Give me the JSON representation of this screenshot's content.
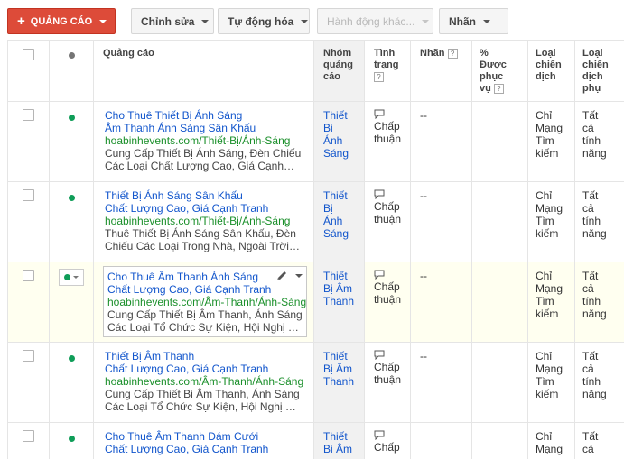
{
  "toolbar": {
    "add_label": "QUẢNG CÁO",
    "edit_label": "Chỉnh sửa",
    "automate_label": "Tự động hóa",
    "more_actions_label": "Hành động khác...",
    "labels_label": "Nhãn"
  },
  "columns": {
    "ad": "Quảng cáo",
    "ad_group": [
      "Nhóm",
      "quảng",
      "cáo"
    ],
    "status": [
      "Tình",
      "trạng"
    ],
    "labels": "Nhãn",
    "percent_served": [
      "%",
      "Được",
      "phục",
      "vụ"
    ],
    "campaign_type": [
      "Loại",
      "chiến",
      "dịch"
    ],
    "campaign_subtype": [
      "Loại",
      "chiến",
      "dịch",
      "phụ"
    ],
    "help_glyph": "?"
  },
  "rows": [
    {
      "headline": "Cho Thuê Thiết Bị Ánh Sáng",
      "headline2": "Âm Thanh Ánh Sáng Sân Khấu",
      "url": "hoabinhevents.com/Thiết-Bị/Ánh-Sáng",
      "desc1": "Cung Cấp Thiết Bị Ánh Sáng, Đèn Chiếu",
      "desc2": "Các Loại Chất Lượng Cao, Giá Cạnh…",
      "ad_group": [
        "Thiết",
        "Bị",
        "Ánh",
        "Sáng"
      ],
      "status": [
        "Chấp",
        "thuận"
      ],
      "labels": "--",
      "campaign_type": [
        "Chỉ",
        "Mạng",
        "Tìm",
        "kiếm"
      ],
      "campaign_subtype": [
        "Tất",
        "cả",
        "tính",
        "năng"
      ]
    },
    {
      "headline": "Thiết Bị Ánh Sáng Sân Khấu",
      "headline2": "Chất Lượng Cao, Giá Cạnh Tranh",
      "url": "hoabinhevents.com/Thiết-Bị/Ánh-Sáng",
      "desc1": "Thuê Thiết Bị Ánh Sáng Sân Khấu, Đèn",
      "desc2": "Chiếu Các Loại Trong Nhà, Ngoài Trời…",
      "ad_group": [
        "Thiết",
        "Bị",
        "Ánh",
        "Sáng"
      ],
      "status": [
        "Chấp",
        "thuận"
      ],
      "labels": "--",
      "campaign_type": [
        "Chỉ",
        "Mạng",
        "Tìm",
        "kiếm"
      ],
      "campaign_subtype": [
        "Tất",
        "cả",
        "tính",
        "năng"
      ]
    },
    {
      "headline": "Cho Thuê Âm Thanh Ánh Sáng",
      "headline2": "Chất Lượng Cao, Giá Cạnh Tranh",
      "url": "hoabinhevents.com/Âm-Thanh/Ánh-Sáng",
      "desc1": "Cung Cấp Thiết Bị Âm Thanh, Ánh Sáng",
      "desc2": "Các Loại Tổ Chức Sự Kiện, Hội Nghị …",
      "ad_group": [
        "Thiết",
        "Bị Âm",
        "Thanh"
      ],
      "status": [
        "Chấp",
        "thuận"
      ],
      "labels": "--",
      "campaign_type": [
        "Chỉ",
        "Mạng",
        "Tìm",
        "kiếm"
      ],
      "campaign_subtype": [
        "Tất",
        "cả",
        "tính",
        "năng"
      ]
    },
    {
      "headline": "Thiết Bị Âm Thanh",
      "headline2": "Chất Lượng Cao, Giá Cạnh Tranh",
      "url": "hoabinhevents.com/Âm-Thanh/Ánh-Sáng",
      "desc1": "Cung Cấp Thiết Bị Âm Thanh, Ánh Sáng",
      "desc2": "Các Loại Tổ Chức Sự Kiện, Hội Nghị …",
      "ad_group": [
        "Thiết",
        "Bị Âm",
        "Thanh"
      ],
      "status": [
        "Chấp",
        "thuận"
      ],
      "labels": "--",
      "campaign_type": [
        "Chỉ",
        "Mạng",
        "Tìm",
        "kiếm"
      ],
      "campaign_subtype": [
        "Tất",
        "cả",
        "tính",
        "năng"
      ]
    },
    {
      "headline": "Cho Thuê Âm Thanh Đám Cưới",
      "headline2": "Chất Lượng Cao, Giá Cạnh Tranh",
      "url": "",
      "desc1": "",
      "desc2": "",
      "ad_group": [
        "Thiết",
        "Bị Âm"
      ],
      "status": [
        "Chấp"
      ],
      "labels": "",
      "campaign_type": [
        "Chỉ",
        "Mạng"
      ],
      "campaign_subtype": [
        "Tất",
        "cả"
      ]
    }
  ],
  "colors": {
    "primary_button": "#dd4b39",
    "link": "#1155cc",
    "url_green": "#1a8f2a",
    "status_green": "#0f9d58"
  },
  "icons": [
    "plus-icon",
    "caret-down-icon",
    "status-dot-icon",
    "pencil-icon",
    "speech-bubble-icon",
    "help-icon"
  ]
}
